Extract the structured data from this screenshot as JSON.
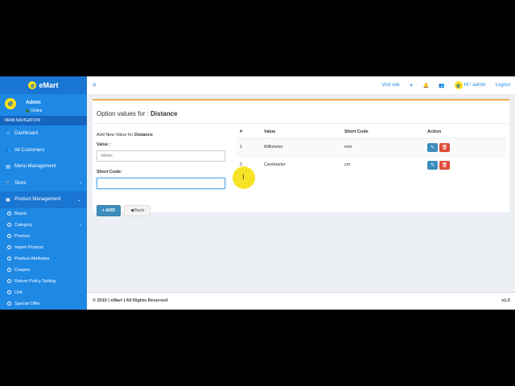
{
  "brand": {
    "logo_letter": "e",
    "name": "eMart"
  },
  "user": {
    "name": "Admin",
    "status": "Online"
  },
  "sidebar": {
    "header": "MAIN NAVIGATION",
    "items": [
      {
        "label": "Dashboard",
        "icon": "dashboard-icon"
      },
      {
        "label": "All Customers",
        "icon": "users-icon"
      },
      {
        "label": "Menu Management",
        "icon": "menu-icon"
      },
      {
        "label": "Store",
        "icon": "cart-icon"
      },
      {
        "label": "Product Management",
        "icon": "box-icon"
      }
    ],
    "sub_items": [
      {
        "label": "Brand"
      },
      {
        "label": "Category"
      },
      {
        "label": "Product"
      },
      {
        "label": "Import Product"
      },
      {
        "label": "Product Attributes"
      },
      {
        "label": "Coupon"
      },
      {
        "label": "Return Policy Setting"
      },
      {
        "label": "Unit"
      },
      {
        "label": "Special Offer"
      }
    ]
  },
  "topbar": {
    "visit_site": "Visit site",
    "greeting": "Hi ! admin",
    "logout": "Logout"
  },
  "page": {
    "title_prefix": "Option values for :",
    "title_name": "Distance"
  },
  "form": {
    "add_prefix": "Add New Value for",
    "add_name": "Distance",
    "value_label": "Value :",
    "value_placeholder": "Meter",
    "short_code_label": "Short Code:",
    "short_code_value": "",
    "add_button": "ADD",
    "back_button": "Back"
  },
  "table": {
    "headers": [
      "#",
      "Value",
      "Short Code",
      "Action"
    ],
    "rows": [
      {
        "num": "1",
        "value": "Millimeter",
        "code": "mm"
      },
      {
        "num": "2",
        "value": "Centimeter",
        "code": "cm"
      }
    ]
  },
  "footer": {
    "copyright": "© 2019 | eMart | All Rights Reserved",
    "version": "v1.0"
  },
  "colors": {
    "sidebar": "#1e88e5",
    "accent": "#3c8dbc",
    "danger": "#dd4b39",
    "box_top": "#f0ad4e"
  }
}
